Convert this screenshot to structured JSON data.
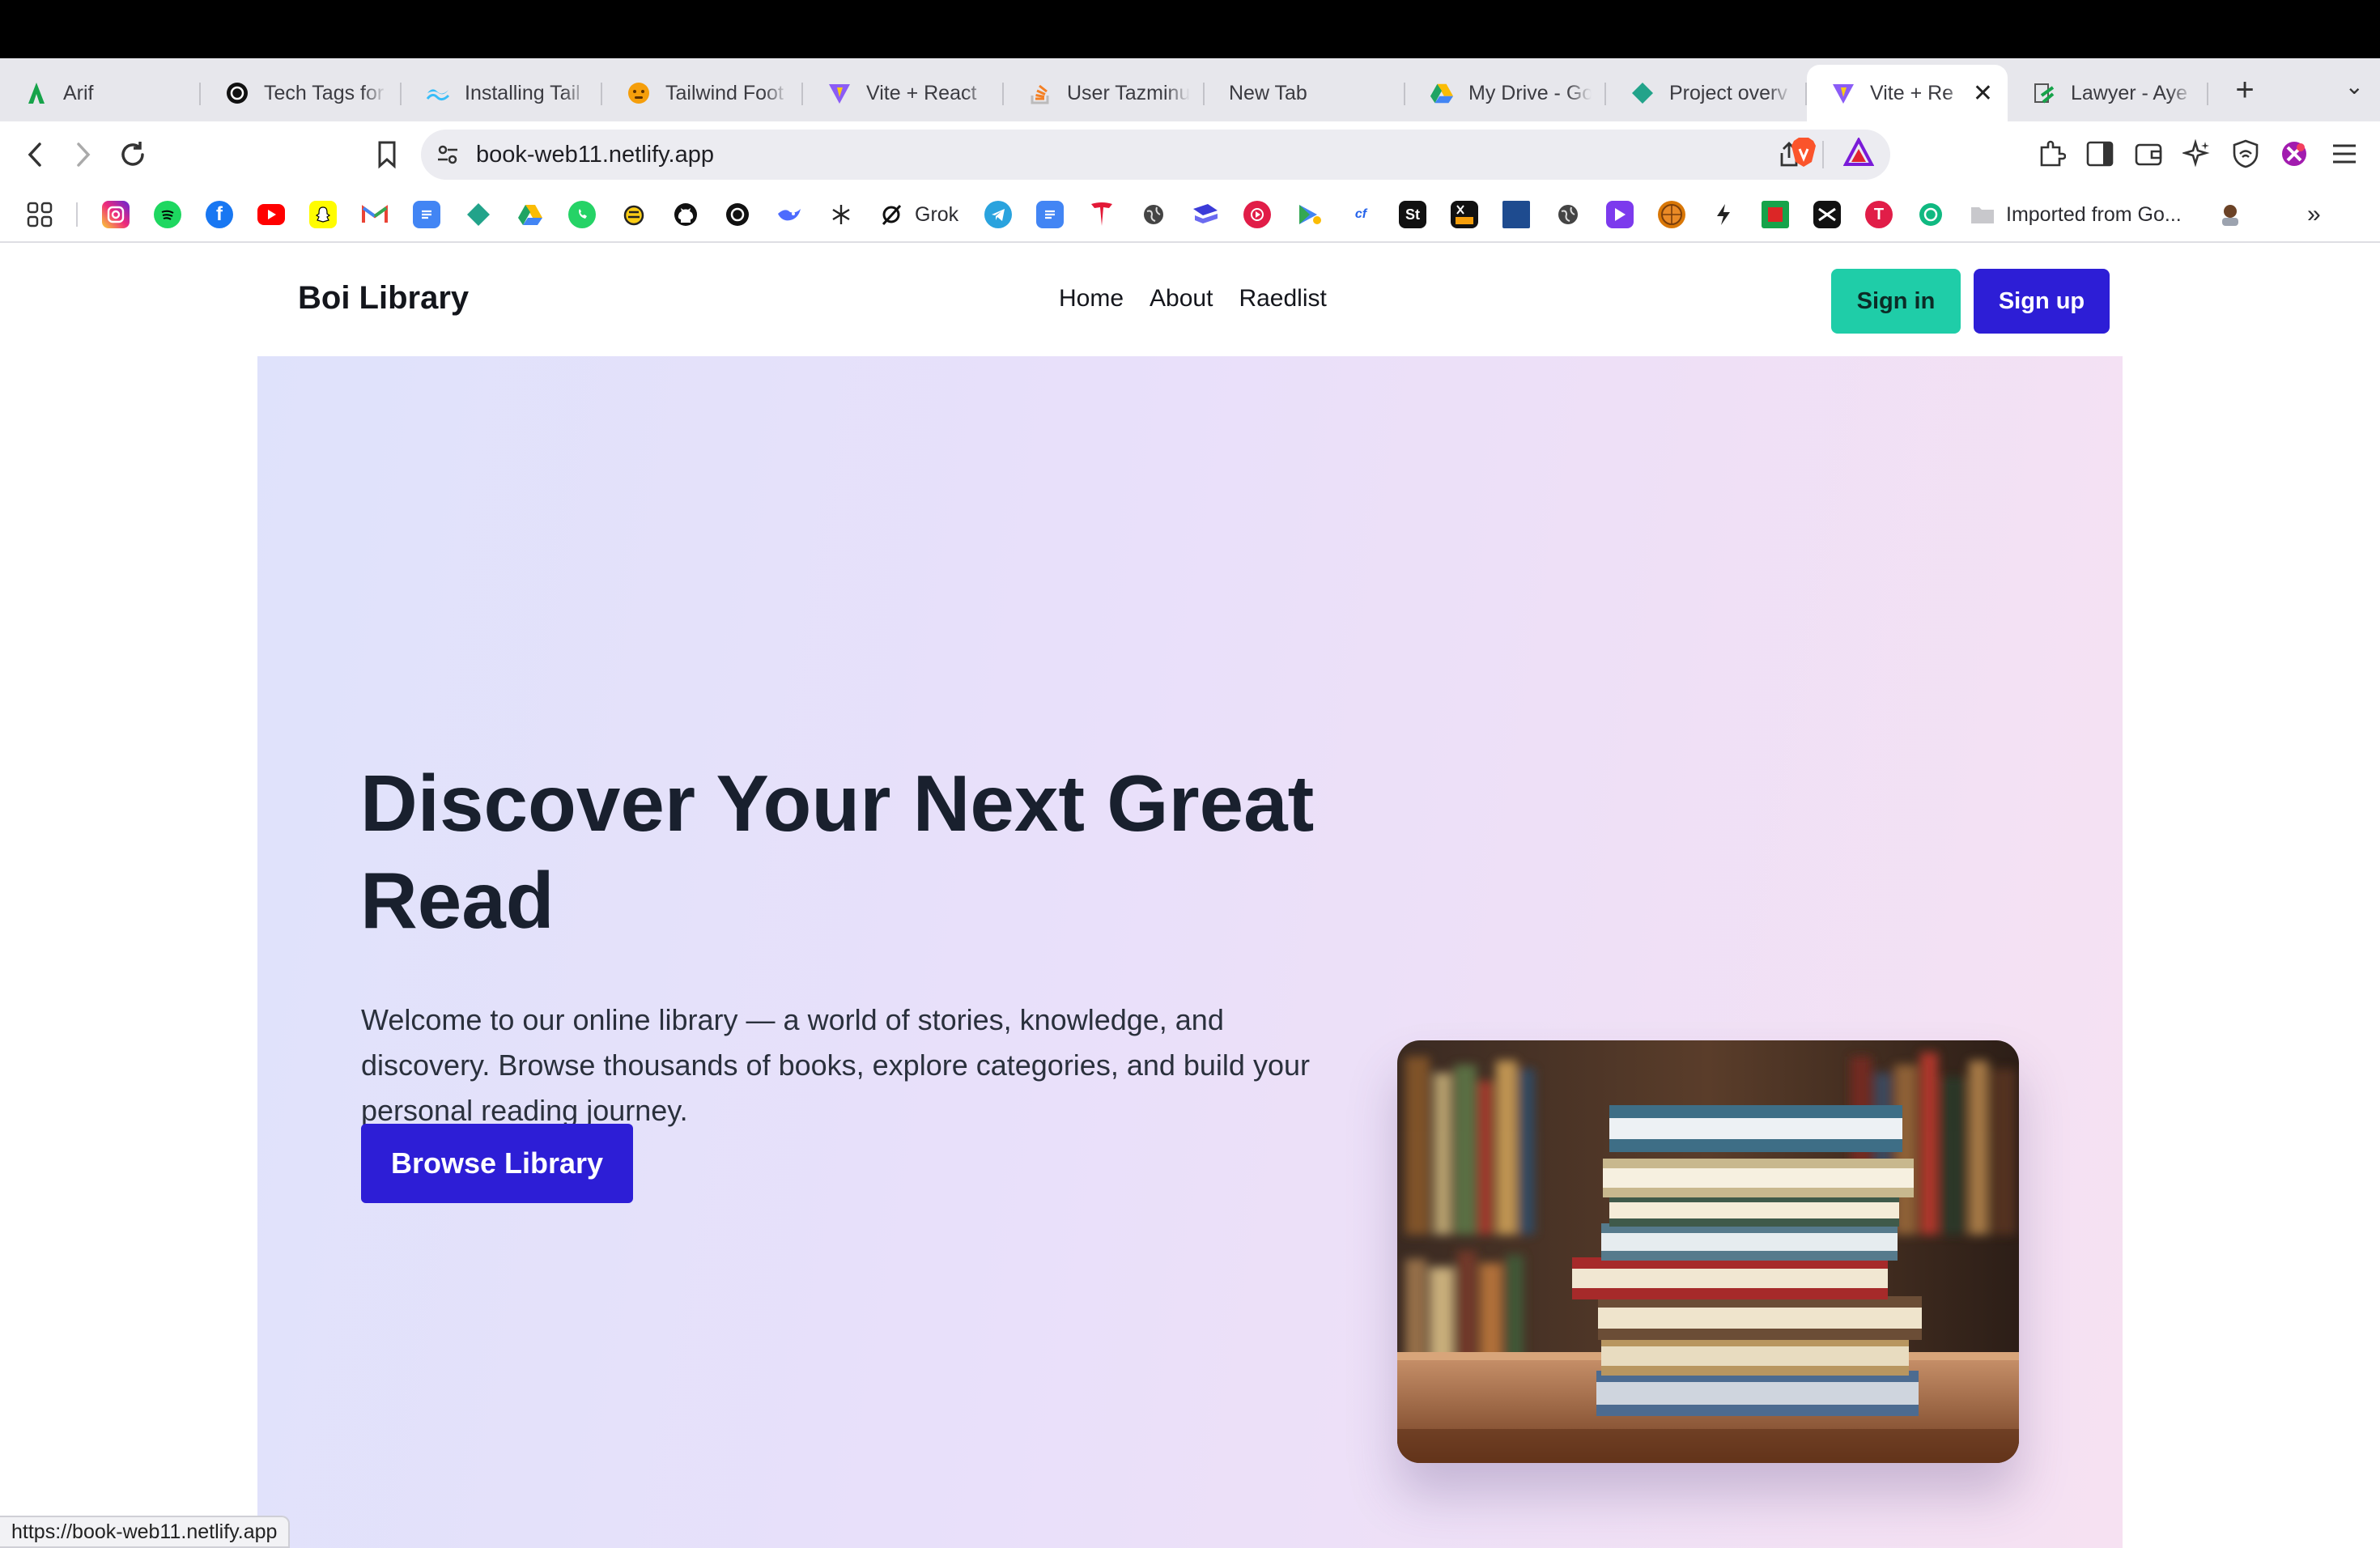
{
  "browser": {
    "tabs": [
      {
        "label": "Arif",
        "icon": "arif-app-icon",
        "color": "#16a34a"
      },
      {
        "label": "Tech Tags for",
        "icon": "openai-icon",
        "color": "#111111"
      },
      {
        "label": "Installing Tail",
        "icon": "tailwind-icon",
        "color": "#38bdf8"
      },
      {
        "label": "Tailwind Foot",
        "icon": "emoji-icon",
        "color": "#f59e0b"
      },
      {
        "label": "Vite + React",
        "icon": "vite-icon",
        "color": "#8b5cf6"
      },
      {
        "label": "User Tazminu",
        "icon": "stackoverflow-icon",
        "color": "#f48024"
      },
      {
        "label": "New Tab",
        "icon": "",
        "color": ""
      },
      {
        "label": "My Drive - Go",
        "icon": "google-drive-icon",
        "color": "#1fa463"
      },
      {
        "label": "Project overv",
        "icon": "diamond-icon",
        "color": "#22a38a"
      },
      {
        "label": "Vite + Re",
        "icon": "vite-icon",
        "color": "#8b5cf6",
        "active": true
      },
      {
        "label": "Lawyer - Aye",
        "icon": "gavel-icon",
        "color": "#16a34a"
      }
    ],
    "new_tab": "+",
    "tab_menu": "⌄",
    "close": "✕",
    "address": {
      "url": "book-web11.netlify.app"
    },
    "bookmarks_folder_label": "Imported from Go...",
    "grok_label": "Grok",
    "more_bookmarks": "»",
    "status_url": "https://book-web11.netlify.app"
  },
  "site": {
    "brand": "Boi Library",
    "nav": [
      "Home",
      "About",
      "Raedlist"
    ],
    "signin": "Sign in",
    "signup": "Sign up",
    "hero": {
      "title": "Discover Your Next Great Read",
      "text": "Welcome to our online library — a world of stories, knowledge, and discovery. Browse thousands of books, explore categories, and build your personal reading journey.",
      "button": "Browse Library",
      "image_subject": "stack-of-books-photo"
    },
    "colors": {
      "primary": "#2d1ed6",
      "signin": "#1fcda8"
    }
  }
}
